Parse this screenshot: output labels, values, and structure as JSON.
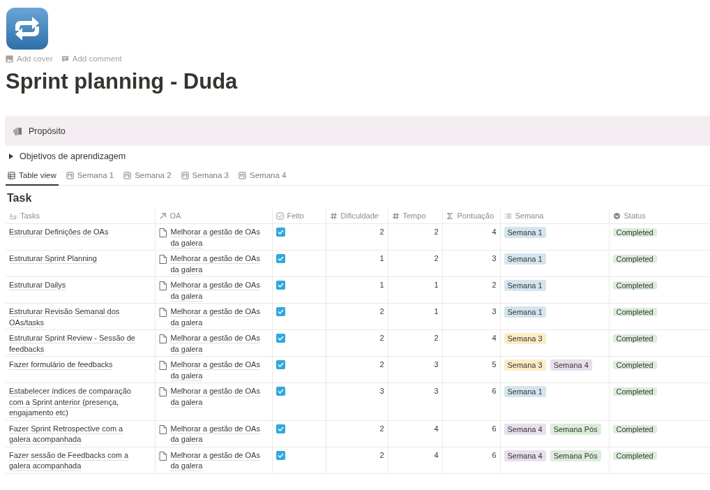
{
  "page": {
    "cover_action": "Add cover",
    "comment_action": "Add comment",
    "title": "Sprint planning - Duda"
  },
  "callout": {
    "text": "Propósito"
  },
  "toggle": {
    "text": "Objetivos de aprendizagem",
    "expanded": false
  },
  "tabs": [
    {
      "label": "Table view",
      "kind": "table",
      "selected": true
    },
    {
      "label": "Semana 1",
      "kind": "board",
      "selected": false
    },
    {
      "label": "Semana 2",
      "kind": "board",
      "selected": false
    },
    {
      "label": "Semana 3",
      "kind": "board",
      "selected": false
    },
    {
      "label": "Semana 4",
      "kind": "board",
      "selected": false
    }
  ],
  "table": {
    "title": "Task",
    "columns": [
      {
        "label": "Tasks",
        "kind": "title"
      },
      {
        "label": "OA",
        "kind": "relation"
      },
      {
        "label": "Feito",
        "kind": "checkbox"
      },
      {
        "label": "Dificuldade",
        "kind": "number"
      },
      {
        "label": "Tempo",
        "kind": "number"
      },
      {
        "label": "Pontuação",
        "kind": "formula"
      },
      {
        "label": "Semana",
        "kind": "multiselect"
      },
      {
        "label": "Status",
        "kind": "status"
      }
    ],
    "rows": [
      {
        "task": "Estruturar Definições de OAs",
        "oa": "Melhorar a gestão de OAs da galera",
        "done": true,
        "dificuldade": "2",
        "tempo": "2",
        "pontuacao": "4",
        "semana": [
          {
            "label": "Semana 1",
            "color": "#d3e5ef"
          }
        ],
        "status": {
          "label": "Completed",
          "color": "#dbeddb"
        }
      },
      {
        "task": "Estruturar Sprint Planning",
        "oa": "Melhorar a gestão de OAs da galera",
        "done": true,
        "dificuldade": "1",
        "tempo": "2",
        "pontuacao": "3",
        "semana": [
          {
            "label": "Semana 1",
            "color": "#d3e5ef"
          }
        ],
        "status": {
          "label": "Completed",
          "color": "#dbeddb"
        }
      },
      {
        "task": "Estruturar Dailys",
        "oa": "Melhorar a gestão de OAs da galera",
        "done": true,
        "dificuldade": "1",
        "tempo": "1",
        "pontuacao": "2",
        "semana": [
          {
            "label": "Semana 1",
            "color": "#d3e5ef"
          }
        ],
        "status": {
          "label": "Completed",
          "color": "#dbeddb"
        }
      },
      {
        "task": "Estruturar Revisão Semanal dos OAs/tasks",
        "oa": "Melhorar a gestão de OAs da galera",
        "done": true,
        "dificuldade": "2",
        "tempo": "1",
        "pontuacao": "3",
        "semana": [
          {
            "label": "Semana 1",
            "color": "#d3e5ef"
          }
        ],
        "status": {
          "label": "Completed",
          "color": "#dbeddb"
        }
      },
      {
        "task": "Estruturar Sprint Review - Sessão de feedbacks",
        "oa": "Melhorar a gestão de OAs da galera",
        "done": true,
        "dificuldade": "2",
        "tempo": "2",
        "pontuacao": "4",
        "semana": [
          {
            "label": "Semana 3",
            "color": "#fdecc8"
          }
        ],
        "status": {
          "label": "Completed",
          "color": "#dbeddb"
        }
      },
      {
        "task": "Fazer formulário de feedbacks",
        "oa": "Melhorar a gestão de OAs da galera",
        "done": true,
        "dificuldade": "2",
        "tempo": "3",
        "pontuacao": "5",
        "semana": [
          {
            "label": "Semana 3",
            "color": "#fdecc8"
          },
          {
            "label": "Semana 4",
            "color": "#e8deee"
          }
        ],
        "status": {
          "label": "Completed",
          "color": "#dbeddb"
        }
      },
      {
        "task": "Estabelecer índices de comparação com a Sprint anterior (presença, engajamento etc)",
        "oa": "Melhorar a gestão de OAs da galera",
        "done": true,
        "dificuldade": "3",
        "tempo": "3",
        "pontuacao": "6",
        "semana": [
          {
            "label": "Semana 1",
            "color": "#d3e5ef"
          }
        ],
        "status": {
          "label": "Completed",
          "color": "#dbeddb"
        }
      },
      {
        "task": "Fazer Sprint Retrospective com a galera acompanhada",
        "oa": "Melhorar a gestão de OAs da galera",
        "done": true,
        "dificuldade": "2",
        "tempo": "4",
        "pontuacao": "6",
        "semana": [
          {
            "label": "Semana 4",
            "color": "#e8deee"
          },
          {
            "label": "Semana Pós",
            "color": "#dbeddb"
          }
        ],
        "status": {
          "label": "Completed",
          "color": "#dbeddb"
        }
      },
      {
        "task": "Fazer sessão de Feedbacks com a galera acompanhada",
        "oa": "Melhorar a gestão de OAs da galera",
        "done": true,
        "dificuldade": "2",
        "tempo": "4",
        "pontuacao": "6",
        "semana": [
          {
            "label": "Semana 4",
            "color": "#e8deee"
          },
          {
            "label": "Semana Pós",
            "color": "#dbeddb"
          }
        ],
        "status": {
          "label": "Completed",
          "color": "#dbeddb"
        }
      }
    ]
  }
}
